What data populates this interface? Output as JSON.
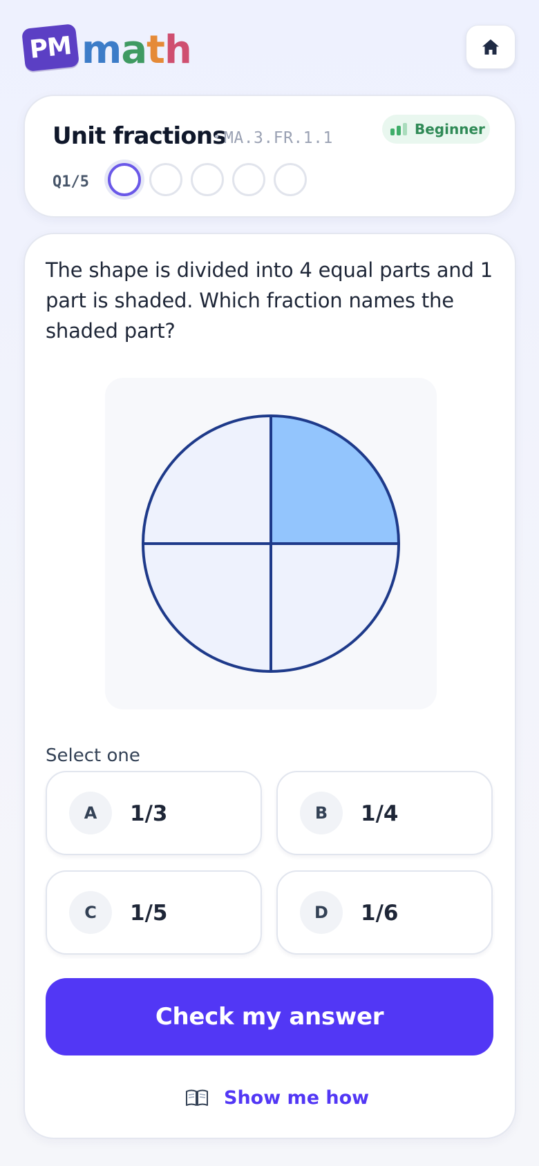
{
  "app": {
    "logo_badge": "PM",
    "logo_word": [
      "m",
      "a",
      "t",
      "h"
    ],
    "logo_colors": {
      "badge": "#5b3fc4",
      "letters": [
        "#3c7cc8",
        "#3f9a62",
        "#e58a37",
        "#cf4f70"
      ]
    },
    "home_icon": "home-icon"
  },
  "topic": {
    "title": "Unit fractions",
    "code": "MA.3.FR.1.1",
    "level": "Beginner",
    "level_bars_filled": 2,
    "level_bars_total": 3
  },
  "progress": {
    "label": "Q1/5",
    "current": 1,
    "total": 5
  },
  "question": {
    "text": "The shape is divided into 4 equal parts and 1 part is shaded. Which fraction names the shaded part?",
    "figure": {
      "shape": "circle",
      "parts": 4,
      "shaded_parts": 1,
      "shaded_quadrant": "top-right",
      "colors": {
        "shaded": "#93c5fd",
        "unshaded": "#eef2fd",
        "outline": "#1e3a8a"
      }
    }
  },
  "answers": {
    "prompt": "Select one",
    "options": [
      {
        "letter": "A",
        "value": "1/3"
      },
      {
        "letter": "B",
        "value": "1/4"
      },
      {
        "letter": "C",
        "value": "1/5"
      },
      {
        "letter": "D",
        "value": "1/6"
      }
    ]
  },
  "actions": {
    "check_label": "Check my answer",
    "show_how_label": "Show me how",
    "show_how_icon": "book-icon",
    "accent": "#5237f5"
  }
}
